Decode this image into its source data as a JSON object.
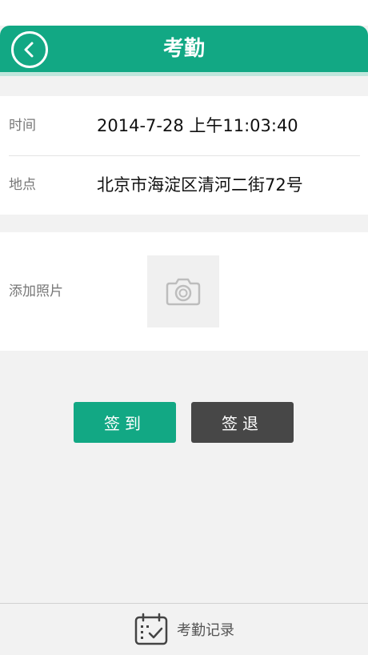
{
  "header": {
    "title": "考勤",
    "back_icon": "back-arrow-icon"
  },
  "info": {
    "time_label": "时间",
    "time_value": "2014-7-28 上午11:03:40",
    "location_label": "地点",
    "location_value": "北京市海淀区清河二街72号"
  },
  "photo": {
    "label": "添加照片",
    "icon": "camera-icon"
  },
  "actions": {
    "sign_in": "签到",
    "sign_out": "签退"
  },
  "footer": {
    "records_label": "考勤记录",
    "records_icon": "calendar-check-icon"
  },
  "colors": {
    "accent": "#12a884",
    "dark_button": "#474747",
    "background": "#f2f2f2"
  }
}
